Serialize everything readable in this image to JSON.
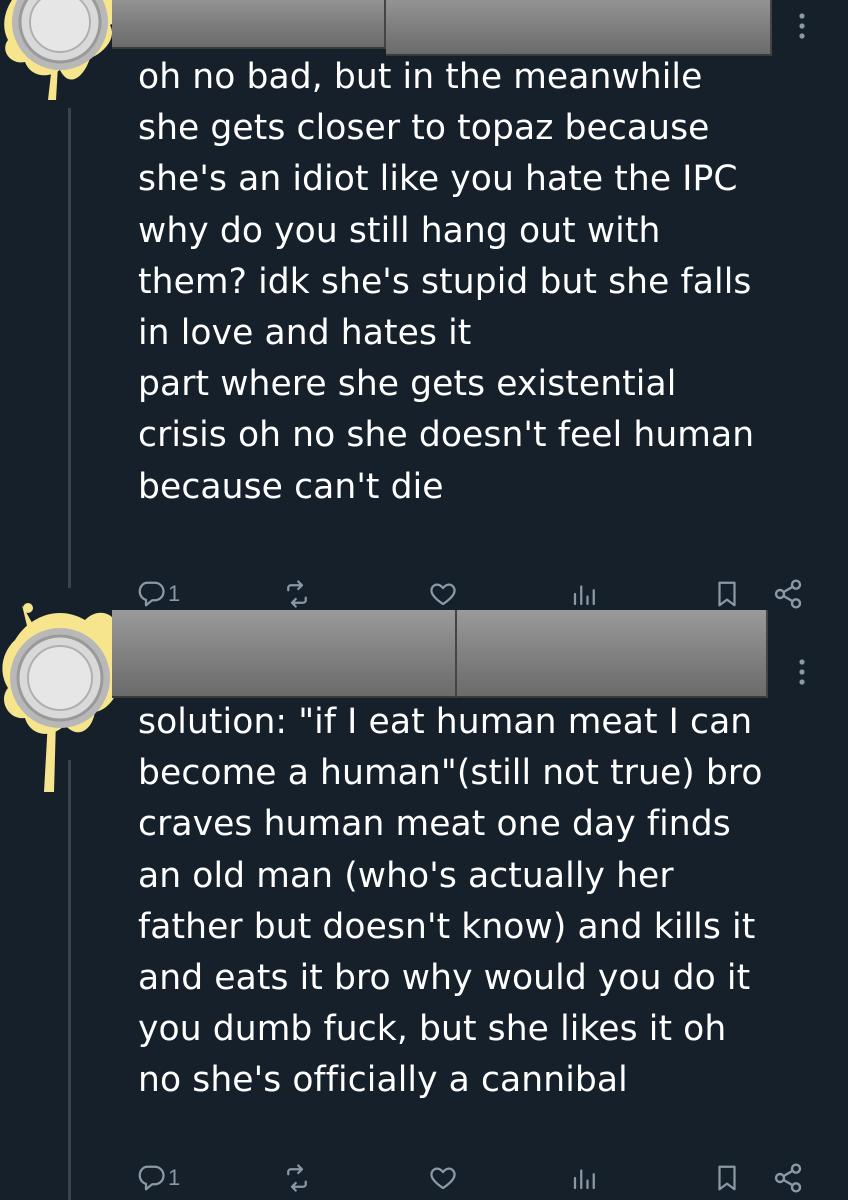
{
  "colors": {
    "background": "#15202b",
    "text": "#ffffff",
    "icon": "#8b98a5",
    "thread_line": "#38444d",
    "redaction": "#8a8a8a"
  },
  "tweets": [
    {
      "avatar_icon": "coin-splash-avatar-icon",
      "text": "oh no bad, but in the meanwhile\nshe gets closer to topaz because\nshe's an idiot like you hate the IPC\nwhy do you still hang out with\nthem? idk she's stupid but she falls\nin love and hates it\npart where she gets existential\ncrisis oh no she doesn't feel human\nbecause can't die",
      "actions": {
        "reply_count": "1",
        "retweet_count": "",
        "like_count": "",
        "view_count": ""
      }
    },
    {
      "avatar_icon": "coin-splash-avatar-icon",
      "text": "solution: \"if I eat human meat I can\nbecome a human\"(still not true) bro\ncraves human meat one day finds\nan old man (who's actually her\nfather but doesn't know) and kills it\nand eats it bro why would you do it\nyou dumb fuck, but she likes it oh\nno she's officially a cannibal",
      "actions": {
        "reply_count": "1",
        "retweet_count": "",
        "like_count": "",
        "view_count": ""
      }
    }
  ],
  "icons": {
    "reply": "reply-icon",
    "retweet": "retweet-icon",
    "like": "heart-icon",
    "views": "views-icon",
    "bookmark": "bookmark-icon",
    "share": "share-icon",
    "more": "more-vertical-icon"
  }
}
